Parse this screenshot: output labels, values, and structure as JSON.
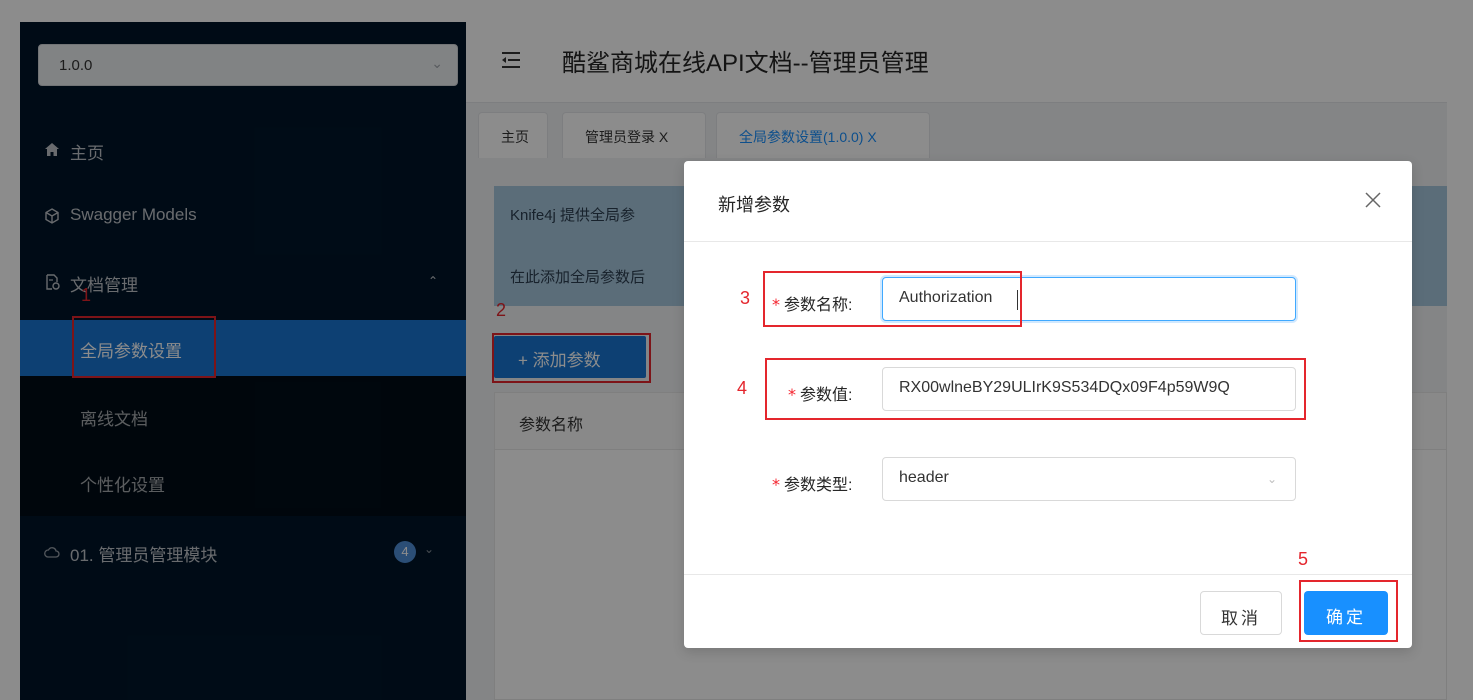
{
  "sidebar": {
    "version": "1.0.0",
    "menu": {
      "home": "主页",
      "swagger_models": "Swagger Models",
      "docs": "文档管理",
      "admin_module": "01. 管理员管理模块",
      "admin_badge": "4"
    },
    "submenu": {
      "global_params": "全局参数设置",
      "offline_docs": "离线文档",
      "personalize": "个性化设置"
    }
  },
  "header": {
    "title": "酷鲨商城在线API文档--管理员管理"
  },
  "tabs": [
    {
      "label": "主页"
    },
    {
      "label": "管理员登录 X"
    },
    {
      "label": "全局参数设置(1.0.0) X"
    }
  ],
  "content": {
    "alert_line1": "Knife4j 提供全局参",
    "alert_line2": "在此添加全局参数后",
    "add_button": "+ 添加参数",
    "table_header_name": "参数名称"
  },
  "modal": {
    "title": "新增参数",
    "fields": {
      "name_label": "参数名称:",
      "name_value": "Authorization",
      "value_label": "参数值:",
      "value_value": "RX00wlneBY29ULIrK9S534DQx09F4p59W9Q",
      "type_label": "参数类型:",
      "type_value": "header",
      "required_mark": "*"
    },
    "cancel": "取消",
    "ok": "确定"
  },
  "annotations": {
    "n1": "1",
    "n2": "2",
    "n3": "3",
    "n4": "4",
    "n5": "5"
  },
  "colors": {
    "sidebar_bg": "#001529",
    "active_item": "#1976d2",
    "primary": "#1890ff",
    "annotation_red": "#e4262d"
  }
}
